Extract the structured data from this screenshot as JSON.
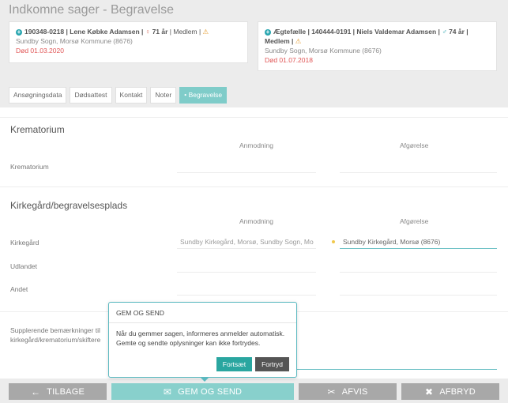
{
  "page": {
    "title": "Indkomne sager - Begravelse"
  },
  "cards": [
    {
      "line1_main": "190348-0218 | Lene Købke Adamsen |",
      "gender_icon": "♀",
      "line1_age": "71 år",
      "line1_status": "| Medlem |",
      "warn_icon": "⚠",
      "address": "Sundby Sogn, Morsø Kommune (8676)",
      "death": "Død 01.03.2020"
    },
    {
      "line1_main": "Ægtefælle | 140444-0191 | Niels Valdemar Adamsen |",
      "gender_icon": "♂",
      "line1_age": "74 år |",
      "line1_status": "Medlem |",
      "warn_icon": "⚠",
      "address": "Sundby Sogn, Morsø Kommune (8676)",
      "death": "Død 01.07.2018"
    }
  ],
  "tabs": [
    {
      "label": "Ansøgningsdata",
      "active": false
    },
    {
      "label": "Dødsattest",
      "active": false
    },
    {
      "label": "Kontakt",
      "active": false
    },
    {
      "label": "Noter",
      "active": false
    },
    {
      "label": "Begravelse",
      "active": true,
      "dot": "●"
    }
  ],
  "crematorium": {
    "title": "Krematorium",
    "col_request": "Anmodning",
    "col_decision": "Afgørelse",
    "row_label": "Krematorium",
    "request_value": "",
    "decision_value": ""
  },
  "cemetery": {
    "title": "Kirkegård/begravelsesplads",
    "col_request": "Anmodning",
    "col_decision": "Afgørelse",
    "rows": [
      {
        "label": "Kirkegård",
        "request": "Sundby Kirkegård, Morsø, Sundby Sogn, Mo",
        "decision": "Sundby Kirkegård, Morsø (8676)"
      },
      {
        "label": "Udlandet",
        "request": "",
        "decision": ""
      },
      {
        "label": "Andet",
        "request": "",
        "decision": ""
      }
    ]
  },
  "remarks": {
    "label_line1": "Supplerende bemærkninger til",
    "label_line2": "kirkegård/krematorium/skiftere"
  },
  "popover": {
    "title": "GEM OG SEND",
    "body_line1": "Når du gemmer sagen, informeres anmelder automatisk.",
    "body_line2": "Gemte og sendte oplysninger kan ikke fortrydes.",
    "confirm": "Fortsæt",
    "cancel": "Fortryd"
  },
  "actions": {
    "back": {
      "label": "TILBAGE",
      "icon": "←"
    },
    "save_send": {
      "label": "GEM OG SEND",
      "icon": "✉"
    },
    "reject": {
      "label": "AFVIS",
      "icon": "✂"
    },
    "abort": {
      "label": "AFBRYD",
      "icon": "✖"
    }
  },
  "colors": {
    "accent": "#2aa6a0",
    "tab_active": "#7fccc9",
    "danger": "#e05555",
    "button_gray": "#a8a8a8"
  }
}
